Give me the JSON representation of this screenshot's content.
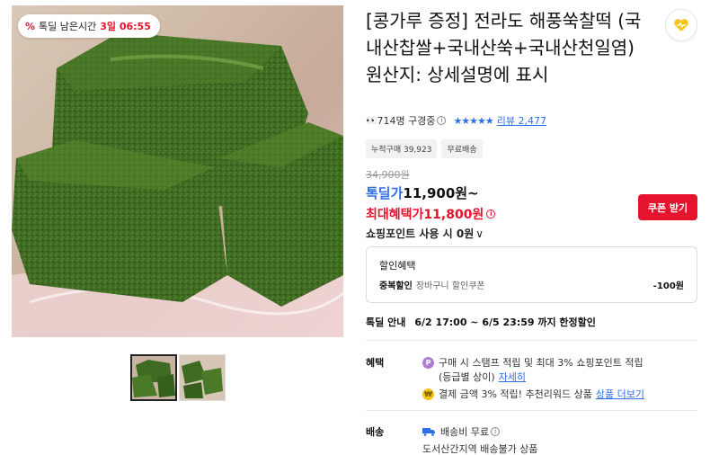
{
  "gallery": {
    "deal_timer": {
      "icon": "percent-icon",
      "label": "톡딜 남은시간",
      "time": "3일 06:55"
    },
    "thumbnails": 2
  },
  "product": {
    "title": "[콩가루 증정] 전라도 해풍쑥찰떡 (국내산찹쌀+국내산쑥+국내산천일염) 원산지: 상세설명에 표시",
    "viewers": "714명 구경중",
    "review_link": "리뷰 2,477",
    "tags": [
      "누적구매 39,923",
      "무료배송"
    ]
  },
  "price": {
    "original": "34,900원",
    "deal_label": "톡딜가",
    "deal_value": "11,900원~",
    "max_label": "최대혜택가",
    "max_value": "11,800원",
    "coupon_button": "쿠폰 받기",
    "points_text": "쇼핑포인트 사용 시 0원",
    "points_chevron": "∨"
  },
  "discount_box": {
    "title": "할인혜택",
    "row_label": "중복할인",
    "row_desc": "장바구니 할인쿠폰",
    "row_amount": "-100원"
  },
  "deal_info": {
    "label": "톡딜 안내",
    "period": "6/2 17:00 ~ 6/5 23:59 까지 한정할인"
  },
  "benefits": {
    "label": "혜택",
    "line1": "구매 시 스탬프 적립 및 최대 3% 쇼핑포인트 적립",
    "line1_sub": "(등급별 상이)",
    "line1_link": "자세히",
    "line2": "결제 금액 3% 적립! 추천리워드 상품",
    "line2_link": "상품 더보기"
  },
  "shipping": {
    "label": "배송",
    "fee": "배송비 무료",
    "note": "도서산간지역 배송불가 상품"
  },
  "colors": {
    "accent_red": "#e5132c",
    "accent_blue": "#2e6ee8",
    "kakao_yellow": "#f5c518"
  }
}
